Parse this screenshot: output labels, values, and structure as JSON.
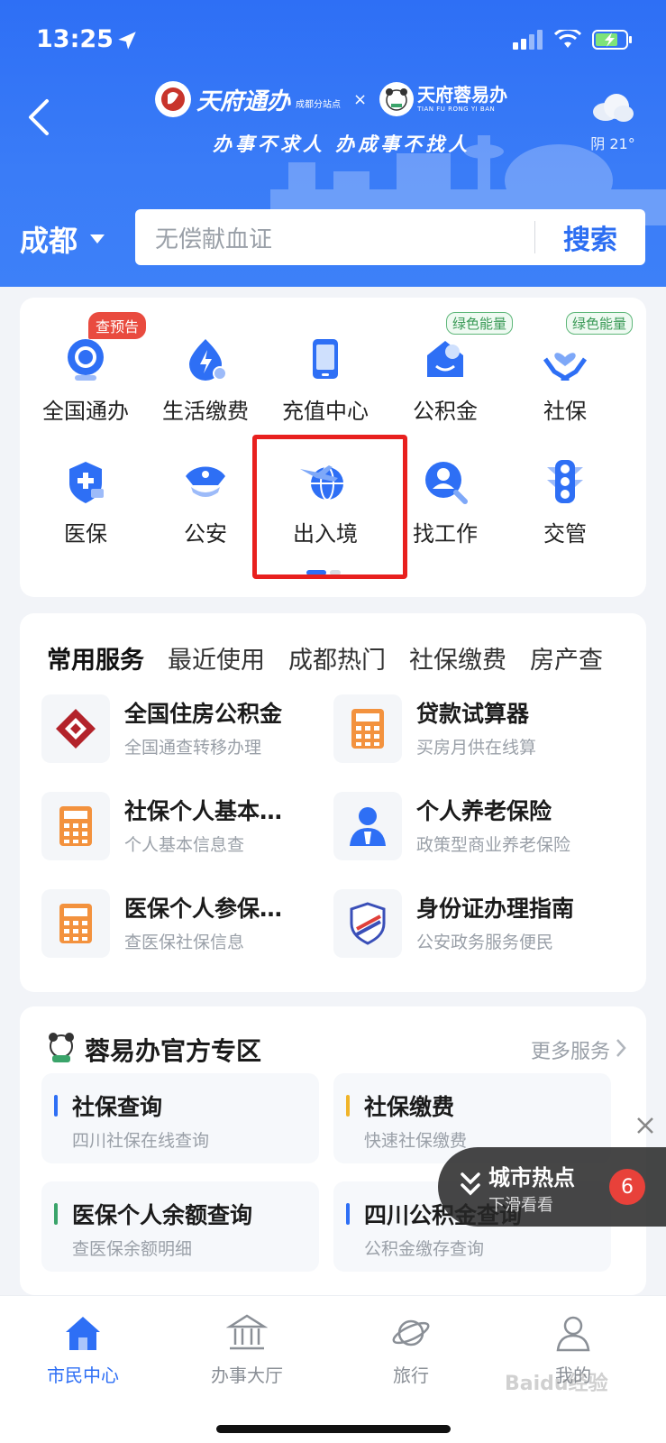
{
  "status_bar": {
    "time": "13:25"
  },
  "header": {
    "brand1_name": "天府通办",
    "brand1_sub": "成都分站点",
    "brand_separator": "×",
    "brand2_name": "天府蓉易办",
    "brand2_pinyin": "TIAN FU RONG YI BAN",
    "slogan": "办事不求人 办成事不找人",
    "weather": "阴 21°"
  },
  "search": {
    "city": "成都",
    "placeholder": "无偿献血证",
    "button": "搜索"
  },
  "quick_grid": {
    "items": [
      {
        "label": "全国通办",
        "icon": "globe-service-icon",
        "badge": "查预告"
      },
      {
        "label": "生活缴费",
        "icon": "utility-bill-icon"
      },
      {
        "label": "充值中心",
        "icon": "phone-recharge-icon"
      },
      {
        "label": "公积金",
        "icon": "housing-fund-icon",
        "badge": "绿色能量"
      },
      {
        "label": "社保",
        "icon": "social-security-icon",
        "badge": "绿色能量"
      },
      {
        "label": "医保",
        "icon": "medical-insurance-icon"
      },
      {
        "label": "公安",
        "icon": "police-cap-icon"
      },
      {
        "label": "出入境",
        "icon": "airplane-globe-icon"
      },
      {
        "label": "找工作",
        "icon": "job-search-icon"
      },
      {
        "label": "交管",
        "icon": "traffic-light-icon"
      }
    ],
    "highlight_color": "#e8201e"
  },
  "services": {
    "tabs": [
      "常用服务",
      "最近使用",
      "成都热门",
      "社保缴费",
      "房产查"
    ],
    "items": [
      {
        "title": "全国住房公积金",
        "subtitle": "全国通查转移办理",
        "icon": "housing-fund-logo-icon"
      },
      {
        "title": "贷款试算器",
        "subtitle": "买房月供在线算",
        "icon": "calculator-icon"
      },
      {
        "title": "社保个人基本…",
        "subtitle": "个人基本信息查",
        "icon": "calculator-icon"
      },
      {
        "title": "个人养老保险",
        "subtitle": "政策型商业养老保险",
        "icon": "person-icon"
      },
      {
        "title": "医保个人参保…",
        "subtitle": "查医保社保信息",
        "icon": "calculator-icon"
      },
      {
        "title": "身份证办理指南",
        "subtitle": "公安政务服务便民",
        "icon": "police-badge-icon"
      }
    ]
  },
  "zone": {
    "title": "蓉易办官方专区",
    "more": "更多服务",
    "items": [
      {
        "title": "社保查询",
        "subtitle": "四川社保在线查询",
        "color": "#2e6ff5"
      },
      {
        "title": "社保缴费",
        "subtitle": "快速社保缴费",
        "color": "#f0b429"
      },
      {
        "title": "医保个人余额查询",
        "subtitle": "查医保余额明细",
        "color": "#3aa46a"
      },
      {
        "title": "四川公积金查询",
        "subtitle": "公积金缴存查询",
        "color": "#2e6ff5"
      }
    ]
  },
  "hotspot": {
    "title": "城市热点",
    "subtitle": "下滑看看",
    "count": "6"
  },
  "bottom_nav": {
    "items": [
      {
        "label": "市民中心",
        "active": true
      },
      {
        "label": "办事大厅",
        "active": false
      },
      {
        "label": "旅行",
        "active": false
      },
      {
        "label": "我的",
        "active": false
      }
    ]
  },
  "watermark": "Baidu经验",
  "colors": {
    "primary": "#2e6ff5",
    "highlight": "#e8201e",
    "badge_red": "#e94b3f",
    "badge_green": "#3a9a57"
  }
}
